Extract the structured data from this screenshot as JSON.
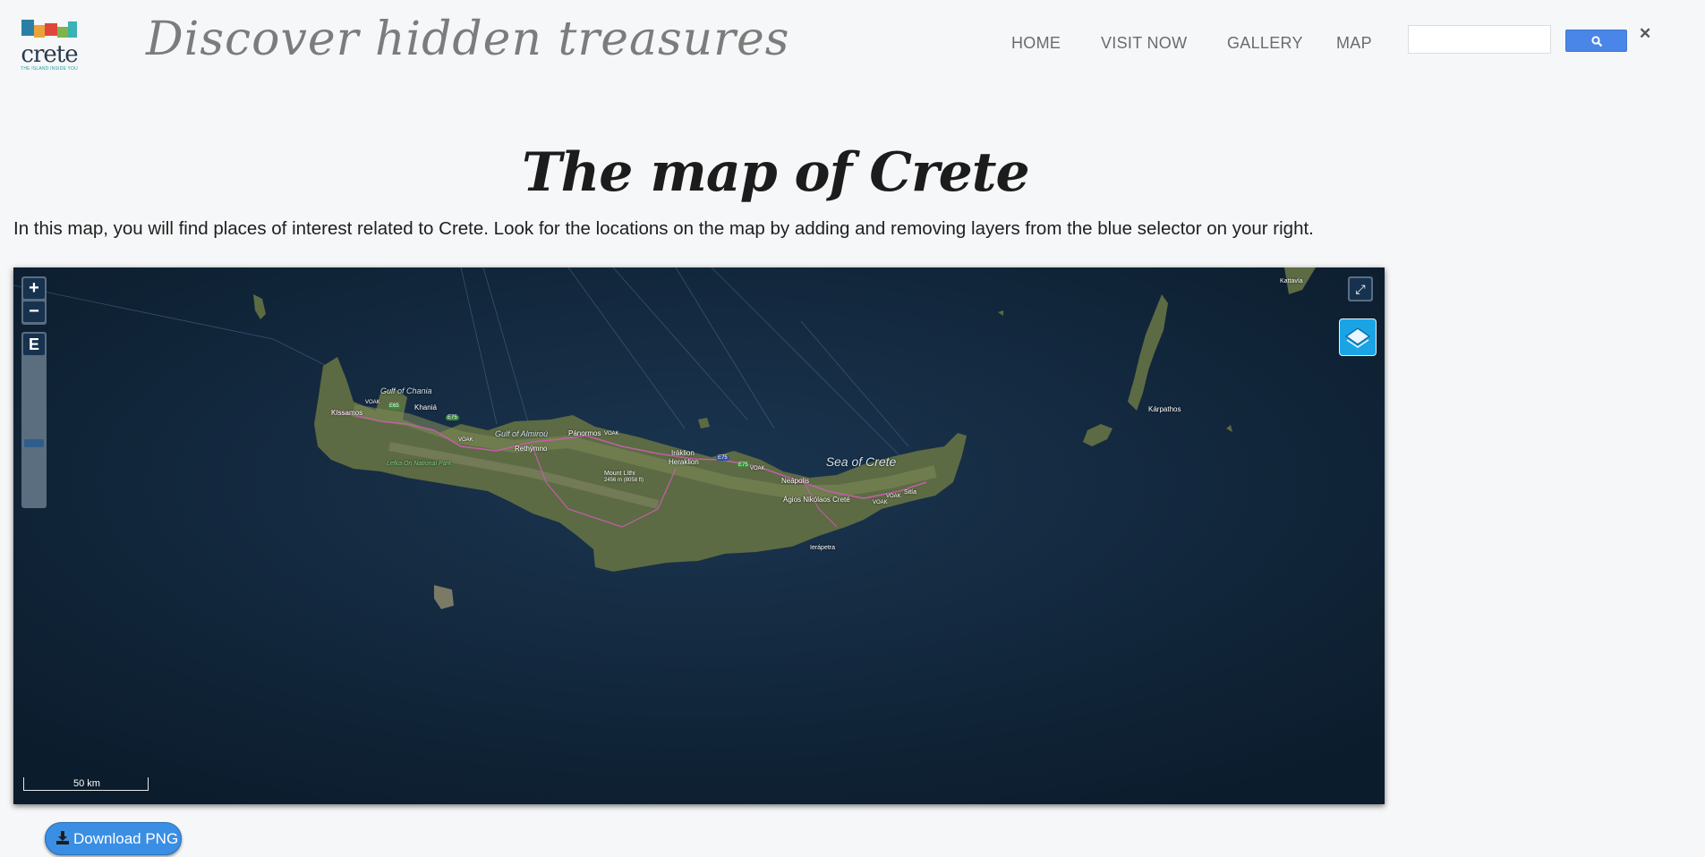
{
  "header": {
    "logo_text": "crete",
    "logo_tagline": "THE ISLAND INSIDE YOU",
    "tagline": "Discover hidden treasures",
    "nav": [
      "HOME",
      "VISIT NOW",
      "GALLERY",
      "MAP"
    ],
    "search": {
      "value": "",
      "placeholder": ""
    },
    "search_button_icon": "search-icon",
    "clear_icon": "✕"
  },
  "main": {
    "title": "The map of Crete",
    "intro": "In this map, you will find places of interest related to Crete. Look for the locations on the map by adding and removing layers from the blue selector on your right."
  },
  "map": {
    "zoom_in": "+",
    "zoom_out": "−",
    "slider_label": "E",
    "zoom_level_fraction": 0.42,
    "fullscreen_icon": "⤢",
    "layers_icon": "layers-icon",
    "scale": "50 km",
    "labels": {
      "gulf_chania": "Gulf of Chania",
      "gulf_almirou": "Gulf of Almiroú",
      "kissamos": "Kíssamos",
      "khania": "Khaniá",
      "rethymno": "Rethýmno",
      "panormos": "Pánormos",
      "iraklion": "Iráklion",
      "heraklion": "Heraklion",
      "lefka_ori": "Lefka Ori National Park",
      "mount_ida": "Mount Líthi",
      "mount_ida_elev": "2456 m (8058 ft)",
      "neapolis": "Neápolis",
      "agios_nikolaos": "Ágios Nikólaos Creté",
      "sitia": "Sitía",
      "ierapetra": "Ierápetra",
      "sea_of_crete": "Sea of Crete",
      "karpathos": "Kárpathos",
      "kattavia": "Kattavía"
    },
    "road_labels": [
      "VOAK",
      "VOAK",
      "VOAK",
      "VOAK",
      "VOAK",
      "VOAK"
    ],
    "route_shields": [
      "E65",
      "E75",
      "E75",
      "E75"
    ]
  },
  "actions": {
    "download_label": "Download PNG"
  },
  "colors": {
    "accent": "#3a8ee4",
    "layers_button": "#1aa4e6",
    "map_sea": "#0f2235",
    "nav_text": "#6b6b6b"
  }
}
